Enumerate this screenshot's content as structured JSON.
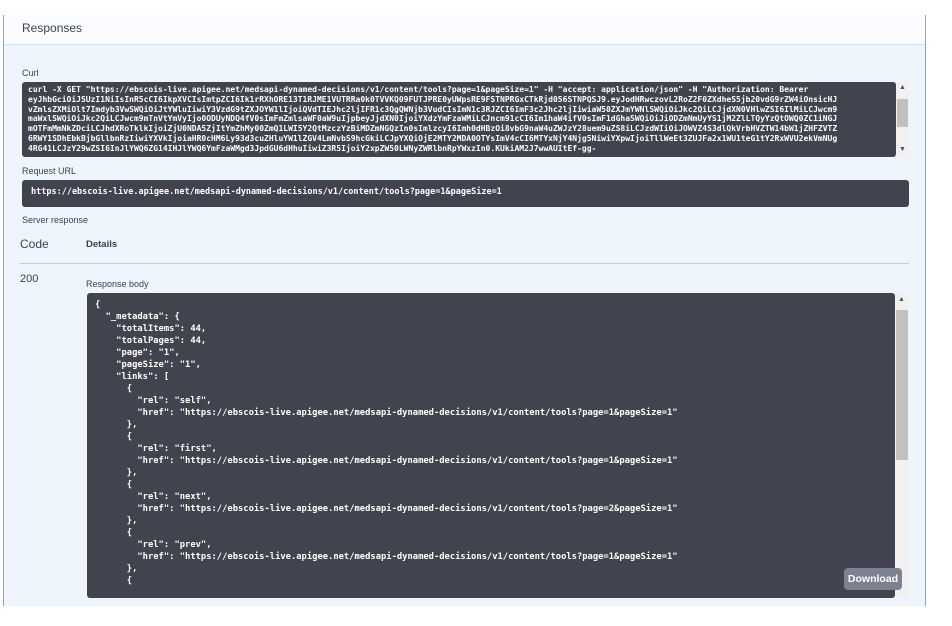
{
  "section_title": "Responses",
  "curl": {
    "label": "Curl",
    "lines": [
      "curl -X GET \"https://ebscois-live.apigee.net/medsapi-dynamed-decisions/v1/content/tools?page=1&pageSize=1\" -H \"accept: application/json\" -H \"Authorization: Bearer",
      "eyJhbGciOiJSUzI1NiIsInR5cCI6IkpXVCIsImtpZCI6Ik1rRXhORE13T1RJME1VUTRRa0k0TVVKQ09FUTJPRE0yUWpsRE9FSTNPRGxCTkRjd056STNPQSJ9.eyJodHRwczovL2RoZ2F0ZXdheS5jb20vdG9rZW4iOnsicHJ",
      "vZmlsZXMiOlt7Imdyb3VwSWQiOiJtYWluIiwiY3VzdG9tZXJOYW1lIjoiQVdTIEJhc2ljIFR1c3QgQWNjb3VudCIsImN1c3RJZCI6ImF3c2Jhc2ljIiwiaW50ZXJmYWNlSWQiOiJkc2QiLCJjdXN0VHlwZSI6IlMiLCJwcm9",
      "maWxlSWQiOiJkc2QiLCJwcm9mTnVtYmVyIjo0ODUyNDQ4fV0sImFmZmlsaWF0aW9uIjpbeyJjdXN0IjoiYXdzYmFzaWMiLCJncm91cCI6Im1haW4ifV0sImF1dGhaSWQiOiJiODZmNmUyYS1jM2ZlLTQyYzQtOWQ0ZC1iNGJ",
      "mOTFmMmNkZDciLCJhdXRoTklkIjoiZjU0NDA5ZjItYmZhMy00ZmQ1LWI5Y2QtMzczYzBiMDZmNGQzIn0sImlzcyI6Imh0dHBzOi8vbG9naW4uZWJzY28uem9uZS8iLCJzdWIiOiJOWVZ4S3dlQkVrbHVZTW14bW1jZHFZVTZ",
      "6RWY1SDhEbkBjbGllbnRzIiwiYXVkIjoiaHR0cHM6Ly93d3cuZHluYW1lZGV4LmNvbS9hcGkiLCJpYXQiOjE2MTY2MDA0OTYsImV4cCI6MTYxNjY4Njg5NiwiYXpwIjoiTllWeEt3ZUJFa2x1WU1teG1tY2RxWVU2ekVmNUg",
      "4RG41LCJzY29wZSI6InJlYWQ6ZG14IHJlYWQ6YmFzaWMgd3JpdGU6dHhuIiwiZ3R5IjoiY2xpZW50LWNyZWRlbnRpYWxzIn0.KUkiAM2J7wwAUItEf-gg-"
    ]
  },
  "request_url": {
    "label": "Request URL",
    "value": "https://ebscois-live.apigee.net/medsapi-dynamed-decisions/v1/content/tools?page=1&pageSize=1"
  },
  "server_response": {
    "label": "Server response",
    "code_header": "Code",
    "details_header": "Details",
    "code": "200",
    "body_label": "Response body",
    "body_lines": [
      "{",
      "  \"_metadata\": {",
      "    \"totalItems\": 44,",
      "    \"totalPages\": 44,",
      "    \"page\": \"1\",",
      "    \"pageSize\": \"1\",",
      "    \"links\": [",
      "      {",
      "        \"rel\": \"self\",",
      "        \"href\": \"https://ebscois-live.apigee.net/medsapi-dynamed-decisions/v1/content/tools?page=1&pageSize=1\"",
      "      },",
      "      {",
      "        \"rel\": \"first\",",
      "        \"href\": \"https://ebscois-live.apigee.net/medsapi-dynamed-decisions/v1/content/tools?page=1&pageSize=1\"",
      "      },",
      "      {",
      "        \"rel\": \"next\",",
      "        \"href\": \"https://ebscois-live.apigee.net/medsapi-dynamed-decisions/v1/content/tools?page=2&pageSize=1\"",
      "      },",
      "      {",
      "        \"rel\": \"prev\",",
      "        \"href\": \"https://ebscois-live.apigee.net/medsapi-dynamed-decisions/v1/content/tools?page=1&pageSize=1\"",
      "      },",
      "      {"
    ],
    "download_label": "Download"
  }
}
